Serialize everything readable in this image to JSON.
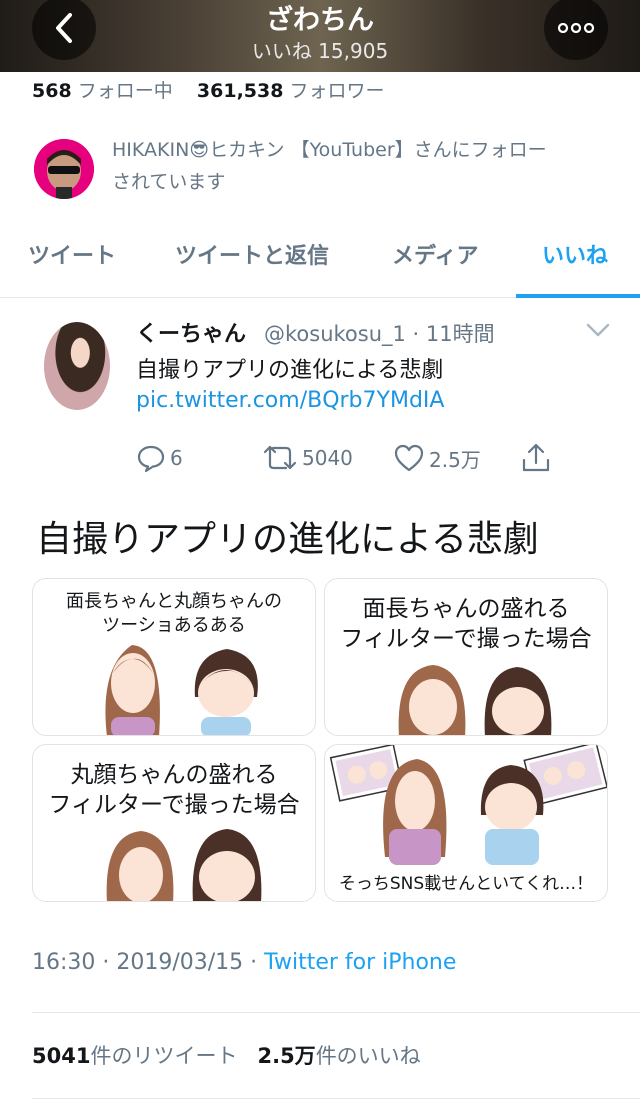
{
  "header": {
    "title": "ざわちん",
    "subtitle": "いいね 15,905"
  },
  "profile": {
    "following_count": "568",
    "following_label": "フォロー中",
    "followers_count": "361,538",
    "followers_label": "フォロワー",
    "followed_by_line1": "HIKAKIN😎ヒカキン 【YouTuber】さんにフォロー",
    "followed_by_line2": "されています"
  },
  "tabs": [
    {
      "label": "ツイート",
      "active": false
    },
    {
      "label": "ツイートと返信",
      "active": false
    },
    {
      "label": "メディア",
      "active": false
    },
    {
      "label": "いいね",
      "active": true
    }
  ],
  "tweet": {
    "name": "くーちゃん",
    "handle": "@kosukosu_1 · 11時間",
    "text": "自撮りアプリの進化による悲劇",
    "link": "pic.twitter.com/BQrb7YMdIA",
    "replies": "6",
    "retweets": "5040",
    "likes": "2.5万"
  },
  "image_card": {
    "title": "自撮りアプリの進化による悲劇",
    "panels": [
      {
        "caption_line1": "面長ちゃんと丸顔ちゃんの",
        "caption_line2": "ツーショあるある"
      },
      {
        "caption_line1": "面長ちゃんの盛れる",
        "caption_line2": "フィルターで撮った場合"
      },
      {
        "caption_line1": "丸顔ちゃんの盛れる",
        "caption_line2": "フィルターで撮った場合"
      },
      {
        "caption_line1": "そっちSNS載せんといてくれ…！",
        "caption_line2": ""
      }
    ]
  },
  "meta": {
    "time": "16:30 · 2019/03/15 · ",
    "source": "Twitter for iPhone"
  },
  "stats": {
    "retweet_count": "5041",
    "retweet_label": "件のリツイート",
    "like_count": "2.5万",
    "like_label": "件のいいね"
  },
  "colors": {
    "accent": "#1da1f2",
    "link": "#1b95e0",
    "muted": "#657786"
  }
}
